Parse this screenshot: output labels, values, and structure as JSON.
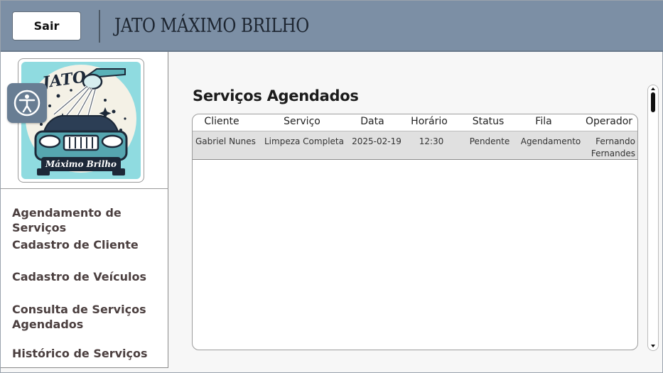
{
  "header": {
    "exit_label": "Sair",
    "title": "JATO MÁXIMO BRILHO"
  },
  "logo": {
    "top_text": "JATO",
    "bottom_text": "Máximo Brilho"
  },
  "accessibility": {
    "icon": "accessibility-icon"
  },
  "sidebar": {
    "items": [
      {
        "label": "Agendamento de Serviços"
      },
      {
        "label": "Cadastro de Cliente"
      },
      {
        "label": "Cadastro de Veículos"
      },
      {
        "label": "Consulta de Serviços Agendados"
      },
      {
        "label": "Histórico de Serviços"
      }
    ]
  },
  "main": {
    "title": "Serviços Agendados",
    "columns": [
      "Cliente",
      "Serviço",
      "Data",
      "Horário",
      "Status",
      "Fila",
      "Operador"
    ],
    "rows": [
      {
        "cliente": "Gabriel Nunes",
        "servico": "Limpeza Completa",
        "data": "2025-02-19",
        "horario": "12:30",
        "status": "Pendente",
        "fila": "Agendamento",
        "operador": "Fernando Fernandes"
      }
    ]
  },
  "colors": {
    "header_bg": "#7c8fa5",
    "accessibility_bg": "#687d93",
    "logo_bg": "#8fdbe0",
    "nav_text": "#4b3f3f"
  }
}
